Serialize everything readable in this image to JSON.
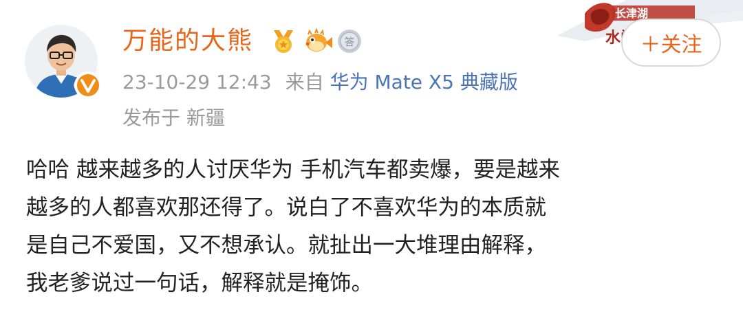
{
  "user": {
    "name": "万能的大熊",
    "avatar_icon": "cartoon-man-avatar",
    "verified_icon": "orange-v-verified-icon",
    "badges": [
      {
        "icon": "gold-medal-badge-icon"
      },
      {
        "icon": "pufferfish-badge-icon"
      },
      {
        "icon": "silver-answer-badge-icon",
        "glyph": "答"
      }
    ]
  },
  "follow_button": {
    "label": "＋关注"
  },
  "meta": {
    "timestamp": "23-10-29 12:43",
    "source_prefix": "来自",
    "source_device": "华为 Mate X5 典藏版",
    "location": "发布于 新疆"
  },
  "post": {
    "lines": [
      "哈哈 越来越多的人讨厌华为 手机汽车都卖爆，要是越来",
      "越多的人都喜欢那还得了。说白了不喜欢华为的本质就",
      "是自己不爱国，又不想承认。就扯出一大堆理由解释，",
      "我老爹说过一句话，解释就是掩饰。"
    ]
  },
  "colors": {
    "username": "#e8651a",
    "meta_gray": "#9a9a9a",
    "link_blue": "#4a74b8",
    "body_text": "#222222"
  }
}
